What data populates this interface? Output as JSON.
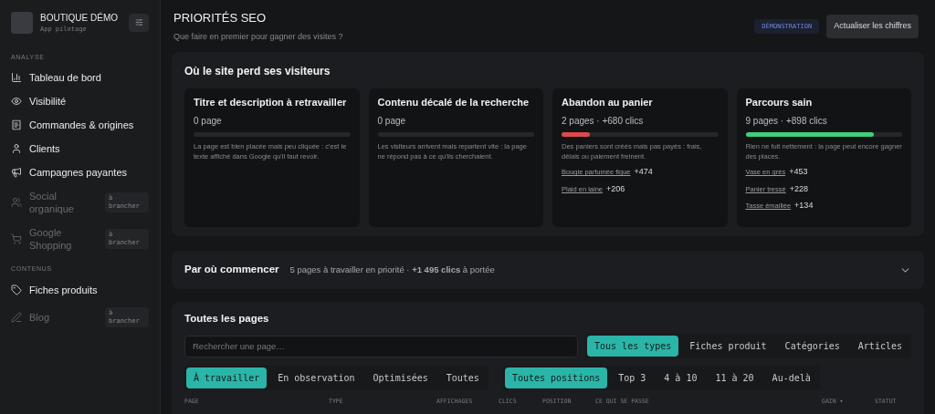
{
  "sidebar": {
    "brand": {
      "name": "BOUTIQUE DÉMO",
      "subtitle": "App pilotage"
    },
    "sections": [
      {
        "title": "ANALYSE",
        "items": [
          {
            "label": "Tableau de bord",
            "kind": "chart",
            "disabled": false
          },
          {
            "label": "Visibilité",
            "kind": "eye",
            "disabled": false
          },
          {
            "label": "Commandes & origines",
            "kind": "receipt",
            "disabled": false
          },
          {
            "label": "Clients",
            "kind": "user",
            "disabled": false
          },
          {
            "label": "Campagnes payantes",
            "kind": "megaphone",
            "disabled": false
          },
          {
            "label": "Social organique",
            "kind": "users",
            "disabled": true,
            "badge": "à brancher"
          },
          {
            "label": "Google Shopping",
            "kind": "cart",
            "disabled": true,
            "badge": "à brancher"
          }
        ]
      },
      {
        "title": "CONTENUS",
        "items": [
          {
            "label": "Fiches produits",
            "kind": "tag",
            "disabled": false
          },
          {
            "label": "Blog",
            "kind": "pen",
            "disabled": true,
            "badge": "à brancher"
          }
        ]
      }
    ]
  },
  "header": {
    "title": "PRIORITÉS SEO",
    "subtitle": "Que faire en premier pour gagner des visites ?",
    "badge": "DÉMONSTRATION",
    "button": "Actualiser les chiffres"
  },
  "losses": {
    "title": "Où le site perd ses visiteurs",
    "cards": [
      {
        "title": "Titre et description à retravailler",
        "count": "0 page",
        "text": "La page est bien placée mais peu cliquée : c'est le texte affiché dans Google qu'il faut revoir."
      },
      {
        "title": "Contenu décalé de la recherche",
        "count": "0 page",
        "text": "Les visiteurs arrivent mais repartent vite : la page ne répond pas à ce qu'ils cherchaient."
      },
      {
        "title": "Abandon au panier",
        "count": "2 pages · +680 clics",
        "level": 0.18,
        "color": "#e0474c",
        "text": "Des paniers sont créés mais pas payés : frais, délais ou paiement freinent.",
        "links": [
          {
            "label": "Bougie parfumée figue",
            "gain": "+474"
          },
          {
            "label": "Plaid en laine",
            "gain": "+206"
          }
        ]
      },
      {
        "title": "Parcours sain",
        "count": "9 pages · +898 clics",
        "level": 0.82,
        "color": "#3ecf7a",
        "text": "Rien ne fuit nettement : la page peut encore gagner des places.",
        "links": [
          {
            "label": "Vase en grès",
            "gain": "+453"
          },
          {
            "label": "Panier tressé",
            "gain": "+228"
          },
          {
            "label": "Tasse émaillée",
            "gain": "+134"
          }
        ]
      }
    ]
  },
  "start": {
    "title": "Par où commencer",
    "summary": "5 pages à travailler en priorité · **+1 495 clics** à portée",
    "expanded": false
  },
  "pages": {
    "title": "Toutes les pages",
    "search_placeholder": "Rechercher une page…",
    "type_filters": [
      {
        "label": "Tous les types",
        "selected": true
      },
      {
        "label": "Fiches produit",
        "selected": false
      },
      {
        "label": "Catégories",
        "selected": false
      },
      {
        "label": "Articles",
        "selected": false
      }
    ],
    "status_filters": [
      {
        "label": "À travailler",
        "selected": true
      },
      {
        "label": "En observation",
        "selected": false
      },
      {
        "label": "Optimisées",
        "selected": false
      },
      {
        "label": "Toutes",
        "selected": false
      }
    ],
    "position_filters": [
      {
        "label": "Toutes positions",
        "selected": true
      },
      {
        "label": "Top 3",
        "selected": false
      },
      {
        "label": "4 à 10",
        "selected": false
      },
      {
        "label": "11 à 20",
        "selected": false
      },
      {
        "label": "Au-delà",
        "selected": false
      }
    ],
    "columns": [
      "PAGE",
      "TYPE",
      "AFFICHAGES",
      "CLICS",
      "POSITION",
      "CE QUI SE PASSE",
      "GAIN ▾",
      "STATUT"
    ]
  }
}
